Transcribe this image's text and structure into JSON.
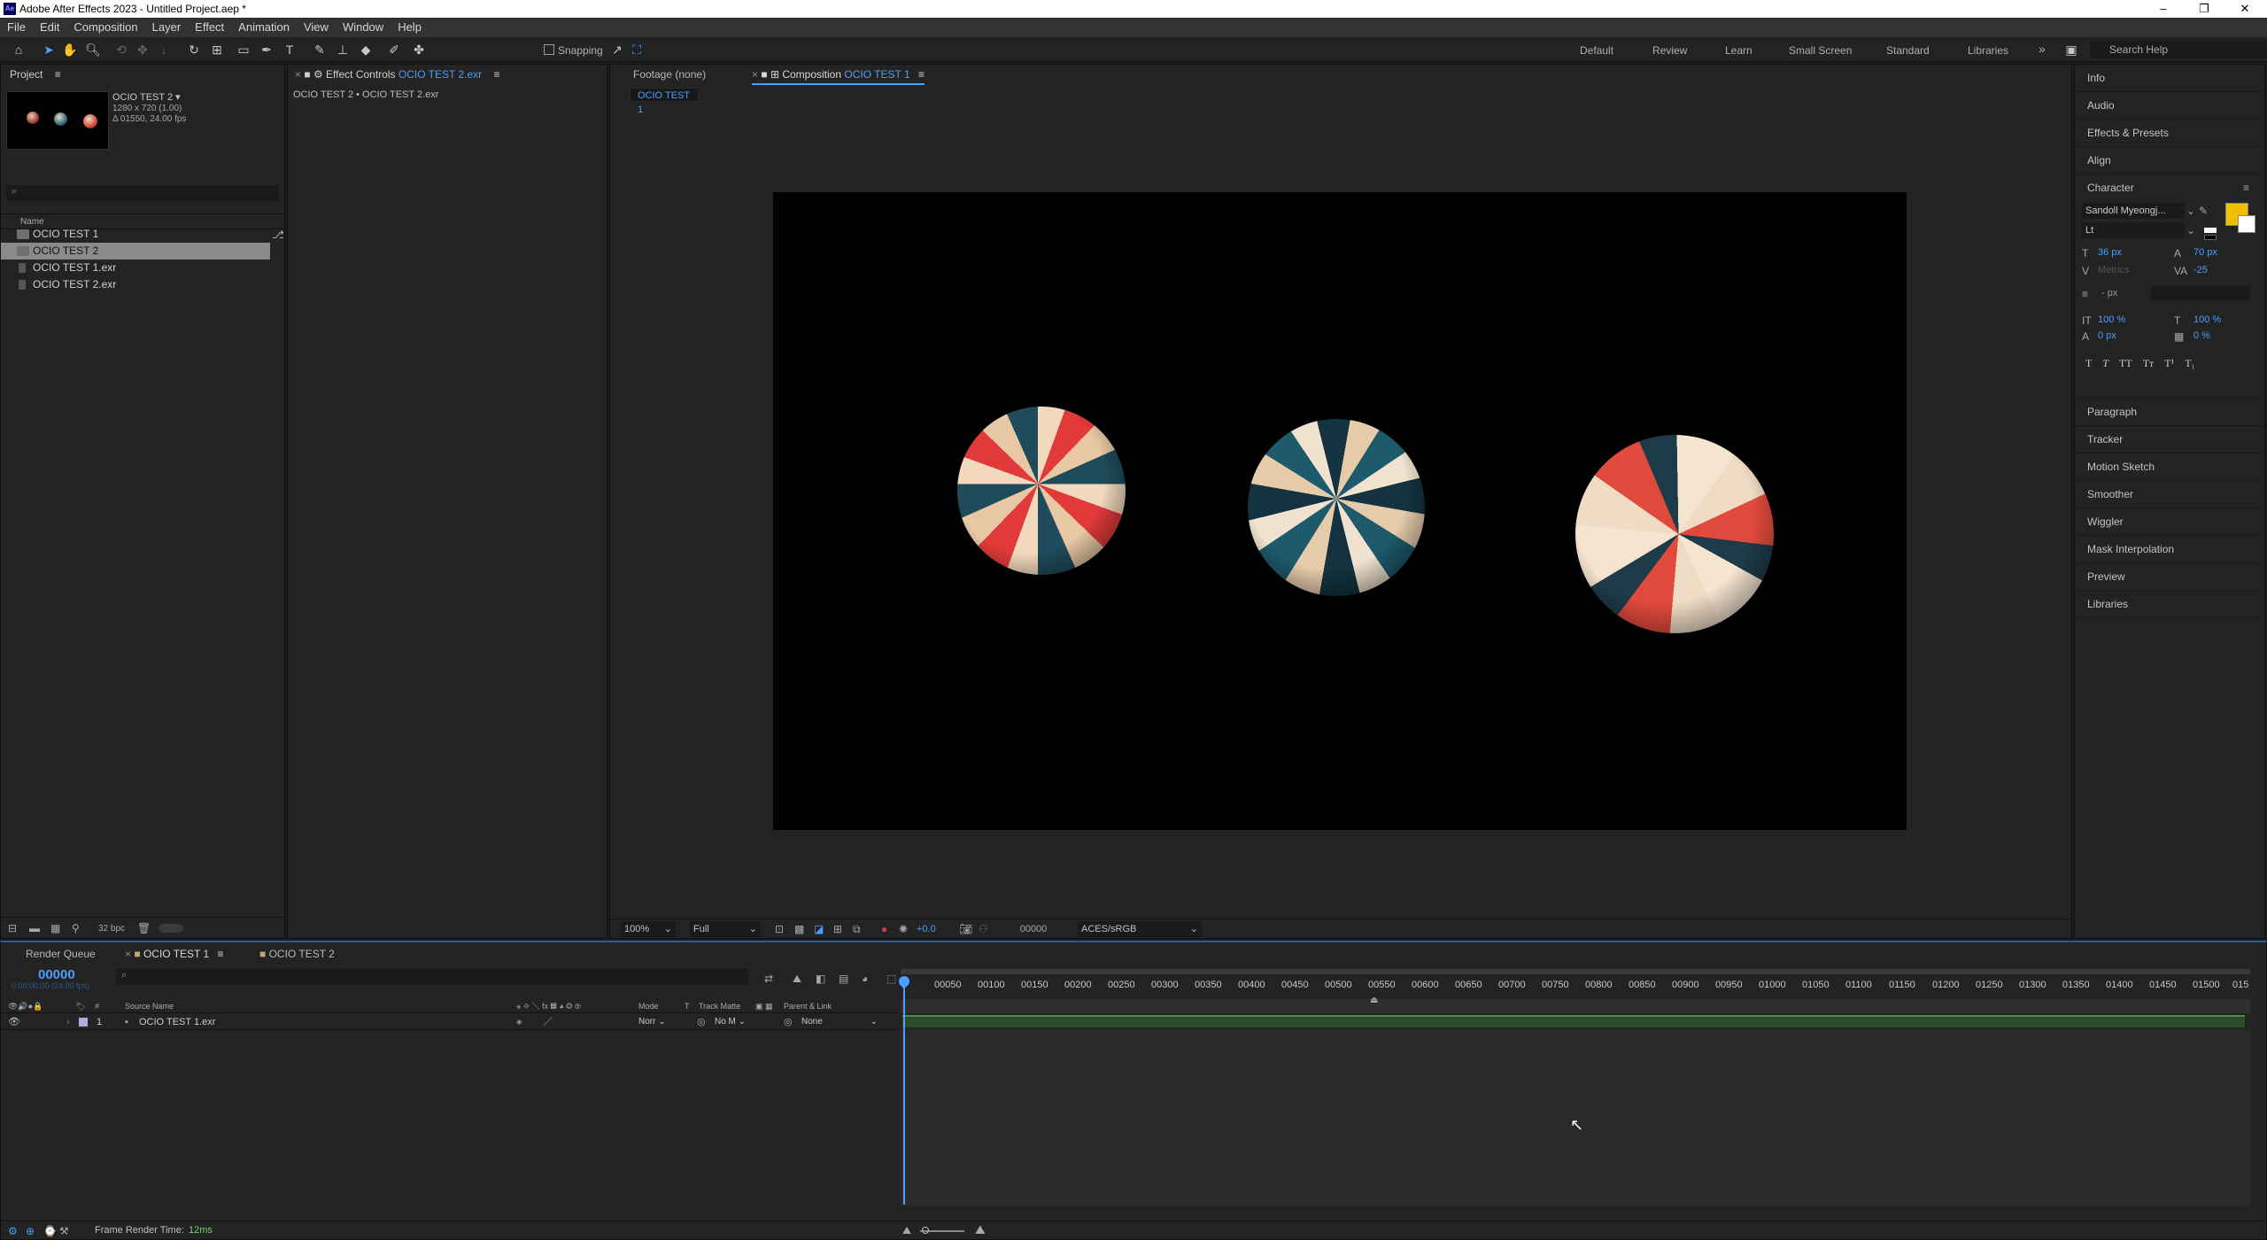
{
  "window": {
    "app_icon": "Ae",
    "title": "Adobe After Effects 2023 - Untitled Project.aep *",
    "controls": {
      "minimize": "–",
      "maximize": "❐",
      "close": "✕"
    }
  },
  "menu": [
    "File",
    "Edit",
    "Composition",
    "Layer",
    "Effect",
    "Animation",
    "View",
    "Window",
    "Help"
  ],
  "toolbar": {
    "snapping_label": "Snapping",
    "workspaces": [
      "Default",
      "Review",
      "Learn",
      "Small Screen",
      "Standard",
      "Libraries"
    ],
    "more_icon": "»",
    "search_placeholder": "Search Help"
  },
  "project_panel": {
    "tab_label": "Project",
    "menu_icon": "≡",
    "selected_item": {
      "name": "OCIO TEST 2 ▾",
      "size": "1280 x 720 (1.00)",
      "duration": "Δ 01550, 24.00 fps"
    },
    "search_placeholder": "",
    "column_name": "Name",
    "items": [
      "OCIO TEST 1",
      "OCIO TEST 2",
      "OCIO TEST 1.exr",
      "OCIO TEST 2.exr"
    ],
    "bpc": "32 bpc"
  },
  "effect_controls": {
    "tab_label": "Effect Controls",
    "tab_target": "OCIO TEST 2.exr",
    "breadcrumb": "OCIO TEST 2 • OCIO TEST 2.exr"
  },
  "viewer": {
    "footage_tab": "Footage",
    "footage_tab_value": "(none)",
    "comp_tab": "Composition",
    "comp_tab_name": "OCIO TEST 1",
    "comp_subtab": "OCIO TEST 1",
    "zoom": "100%",
    "resolution": "Full",
    "exposure": "+0.0",
    "timecode": "00000",
    "color_space": "ACES/sRGB"
  },
  "right_panels": {
    "top": [
      "Info",
      "Audio",
      "Effects & Presets",
      "Align"
    ],
    "character": {
      "title": "Character",
      "font": "Sandoll Myeongj...",
      "style": "Lt",
      "font_size": "36 px",
      "leading": "70 px",
      "kerning": "Metrics",
      "tracking": "-25",
      "stroke": "- px",
      "vscale": "100 %",
      "hscale": "100 %",
      "baseline": "0 px",
      "tsume": "0 %",
      "styles": [
        "T",
        "T",
        "TT",
        "Tт",
        "T¹",
        "T₁"
      ],
      "fill_color": "#f0c000"
    },
    "bottom": [
      "Paragraph",
      "Tracker",
      "Motion Sketch",
      "Smoother",
      "Wiggler",
      "Mask Interpolation",
      "Preview",
      "Libraries"
    ]
  },
  "timeline": {
    "render_queue_tab": "Render Queue",
    "comp_tabs": [
      "OCIO TEST 1",
      "OCIO TEST 2"
    ],
    "current_time": "00000",
    "current_time_sub": "0:00:00:00 (24.00 fps)",
    "search_placeholder": "",
    "columns": {
      "source_name": "Source Name",
      "mode": "Mode",
      "t": "T",
      "track_matte": "Track Matte",
      "parent": "Parent & Link"
    },
    "layer": {
      "index": "1",
      "name": "OCIO TEST 1.exr",
      "mode": "Norr",
      "matte": "No M",
      "parent": "None"
    },
    "ruler_labels": [
      "00050",
      "00100",
      "00150",
      "00200",
      "00250",
      "00300",
      "00350",
      "00400",
      "00450",
      "00500",
      "00550",
      "00600",
      "00650",
      "00700",
      "00750",
      "00800",
      "00850",
      "00900",
      "00950",
      "01000",
      "01050",
      "01100",
      "01150",
      "01200",
      "01250",
      "01300",
      "01350",
      "01400",
      "01450",
      "01500",
      "015"
    ],
    "footer_label": "Frame Render Time:",
    "footer_value": "12ms"
  },
  "colors": {
    "accent": "#4a9fff",
    "layer_bar": "#4d8a4d",
    "playhead": "#4a9fff"
  }
}
